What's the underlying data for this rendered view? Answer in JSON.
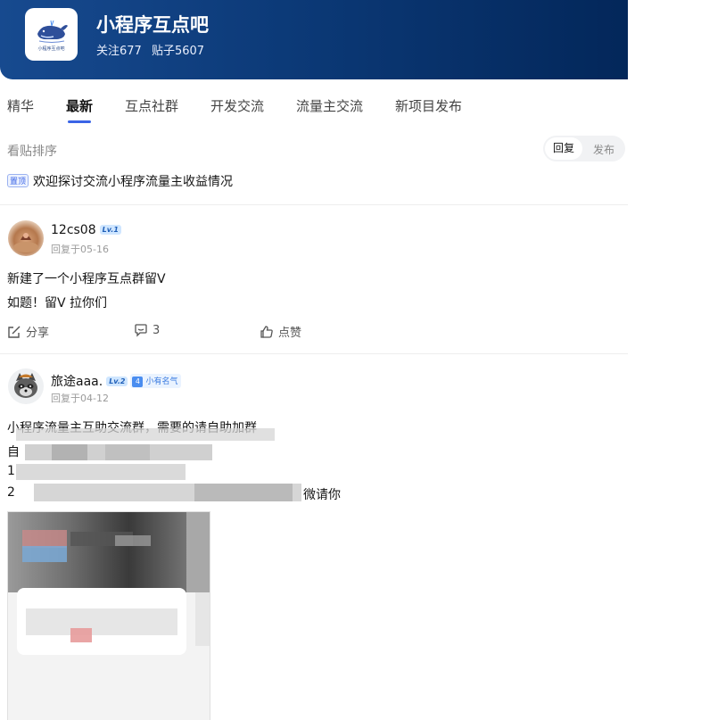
{
  "header": {
    "title": "小程序互点吧",
    "follow_text": "关注677",
    "posts_text": "贴子5607",
    "logo_caption": "小程序互点吧"
  },
  "tabs": [
    {
      "label": "精华"
    },
    {
      "label": "最新"
    },
    {
      "label": "互点社群"
    },
    {
      "label": "开发交流"
    },
    {
      "label": "流量主交流"
    },
    {
      "label": "新项目发布"
    }
  ],
  "sort": {
    "label": "看贴排序",
    "options": [
      "回复",
      "发布"
    ]
  },
  "pinned": {
    "badge": "置顶",
    "title": "欢迎探讨交流小程序流量主收益情况"
  },
  "posts": [
    {
      "username": "12cs08",
      "level": "Lv.1",
      "meta": "回复于05-16",
      "title": "新建了一个小程序互点群留V",
      "body": "如题！留V 拉你们",
      "actions": {
        "share": "分享",
        "comments": "3",
        "like": "点赞"
      }
    },
    {
      "username": "旅途aaa.",
      "level": "Lv.2",
      "badge_level": "4",
      "badge_text": "小有名气",
      "meta": "回复于04-12",
      "title": "小程序流量主互助交流群，需要的请自助加群",
      "line1": "自",
      "line2": "1",
      "line3_start": "2",
      "line3_end": "微请你"
    }
  ],
  "colors": {
    "header_start": "#174a8f",
    "header_end": "#03275a",
    "accent": "#3a64e6"
  }
}
